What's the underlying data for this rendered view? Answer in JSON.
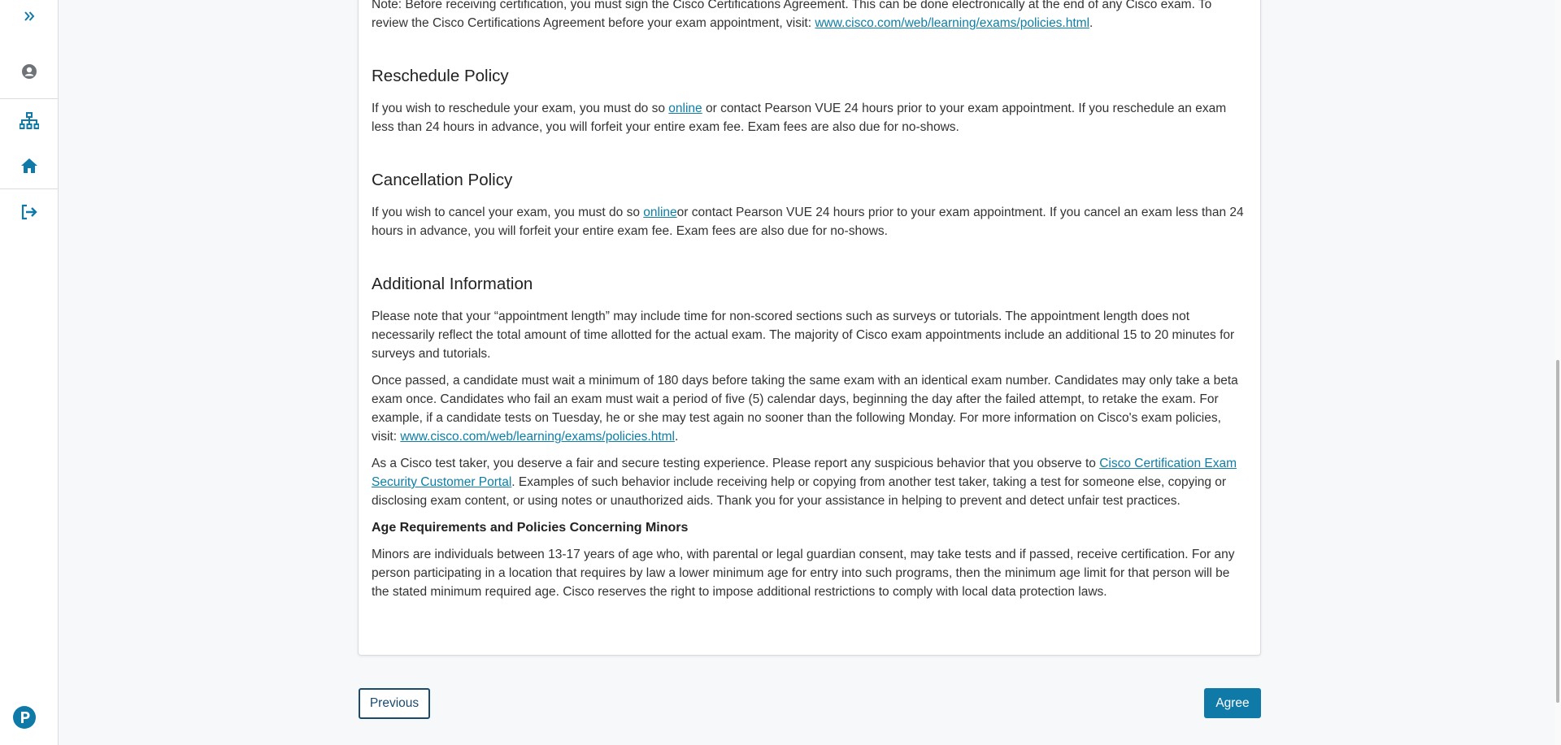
{
  "sidebar": {
    "items": [
      {
        "icon": "chevrons-right-icon",
        "label": "Expand"
      },
      {
        "icon": "user-icon",
        "label": "Profile"
      },
      {
        "icon": "sitemap-icon",
        "label": "Sitemap"
      },
      {
        "icon": "home-icon",
        "label": "Home"
      },
      {
        "icon": "sign-out-icon",
        "label": "Sign out"
      },
      {
        "icon": "pearson-logo-icon",
        "label": "Pearson"
      }
    ],
    "accent": "#0f79a8"
  },
  "main": {
    "note_text_before": "Note: Before receiving certification, you must sign the Cisco Certifications Agreement. This can be done electronically at the end of any Cisco exam. To review the Cisco Certifications Agreement before your exam appointment, visit: ",
    "note_link": "www.cisco.com/web/learning/exams/policies.html",
    "note_text_after": ".",
    "reschedule": {
      "heading": "Reschedule Policy",
      "text_before": "If you wish to reschedule your exam, you must do so ",
      "link": "online",
      "text_after": " or contact Pearson VUE 24 hours prior to your exam appointment. If you reschedule an exam less than 24 hours in advance, you will forfeit your entire exam fee. Exam fees are also due for no-shows."
    },
    "cancellation": {
      "heading": "Cancellation Policy",
      "text_before": "If you wish to cancel your exam, you must do so ",
      "link": "online",
      "text_after": "or contact Pearson VUE 24 hours prior to your exam appointment. If you cancel an exam less than 24 hours in advance, you will forfeit your entire exam fee. Exam fees are also due for no-shows."
    },
    "additional": {
      "heading": "Additional Information",
      "p1": "Please note that your “appointment length” may include time for non-scored sections such as surveys or tutorials. The appointment length does not necessarily reflect the total amount of time allotted for the actual exam. The majority of Cisco exam appointments include an additional 15 to 20 minutes for surveys and tutorials.",
      "p2_before": "Once passed, a candidate must wait a minimum of 180 days before taking the same exam with an identical exam number. Candidates may only take a beta exam once. Candidates who fail an exam must wait a period of five (5) calendar days, beginning the day after the failed attempt, to retake the exam. For example, if a candidate tests on Tuesday, he or she may test again no sooner than the following Monday. For more information on Cisco's exam policies, visit: ",
      "p2_link": "www.cisco.com/web/learning/exams/policies.html",
      "p2_after": ".",
      "p3_before": "As a Cisco test taker, you deserve a fair and secure testing experience. Please report any suspicious behavior that you observe to ",
      "p3_link": "Cisco Certification Exam Security Customer Portal",
      "p3_after": ". Examples of such behavior include receiving help or copying from another test taker, taking a test for someone else, copying or disclosing exam content, or using notes or unauthorized aids. Thank you for your assistance in helping to prevent and detect unfair test practices."
    },
    "minors": {
      "heading": "Age Requirements and Policies Concerning Minors",
      "text": "Minors are individuals between 13-17 years of age who, with parental or legal guardian consent, may take tests and if passed, receive certification. For any person participating in a location that requires by law a lower minimum age for entry into such programs, then the minimum age limit for that person will be the stated minimum required age. Cisco reserves the right to impose additional restrictions to comply with local data protection laws."
    }
  },
  "footer": {
    "previous_label": "Previous",
    "agree_label": "Agree"
  }
}
